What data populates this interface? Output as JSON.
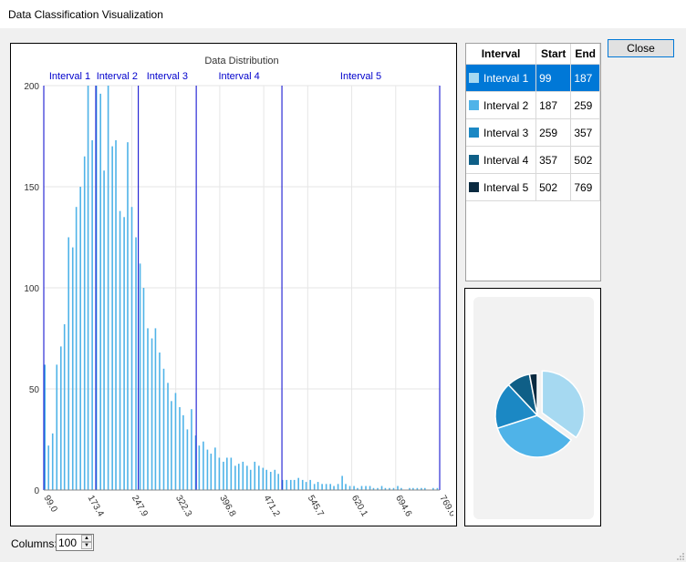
{
  "window": {
    "title": "Data Classification Visualization"
  },
  "close_label": "Close",
  "columns": {
    "label": "Columns:",
    "value": "100"
  },
  "table": {
    "headers": [
      "Interval",
      "Start",
      "End"
    ],
    "rows": [
      {
        "name": "Interval 1",
        "start": "99",
        "end": "187",
        "color": "#a6d9f1"
      },
      {
        "name": "Interval 2",
        "start": "187",
        "end": "259",
        "color": "#4fb3e8"
      },
      {
        "name": "Interval 3",
        "start": "259",
        "end": "357",
        "color": "#1b88c4"
      },
      {
        "name": "Interval 4",
        "start": "357",
        "end": "502",
        "color": "#0f5f87"
      },
      {
        "name": "Interval 5",
        "start": "502",
        "end": "769",
        "color": "#0a2a40"
      }
    ],
    "selected_row": 0
  },
  "chart_data": {
    "type": "bar",
    "title": "Data Distribution",
    "xlim": [
      99,
      769
    ],
    "ylim": [
      0,
      200
    ],
    "yticks": [
      0,
      50,
      100,
      150,
      200
    ],
    "xticks": [
      "99.0",
      "173.4",
      "247.9",
      "322.3",
      "396.8",
      "471.2",
      "545.7",
      "620.1",
      "694.6",
      "769.0"
    ],
    "grid": true,
    "bar_color": "#4fb3e8",
    "interval_line_color": "#0000cc",
    "interval_labels": [
      "Interval 1",
      "Interval 2",
      "Interval 3",
      "Interval 4",
      "Interval 5"
    ],
    "interval_breaks": [
      99,
      187,
      259,
      357,
      502,
      769
    ],
    "bin_centers": [
      101,
      107,
      114,
      121,
      128,
      134,
      141,
      148,
      154,
      161,
      168,
      174,
      181,
      188,
      195,
      201,
      208,
      215,
      221,
      228,
      235,
      241,
      248,
      255,
      262,
      268,
      275,
      282,
      288,
      295,
      302,
      309,
      315,
      322,
      329,
      335,
      342,
      349,
      356,
      362,
      369,
      376,
      382,
      389,
      396,
      403,
      409,
      416,
      423,
      429,
      436,
      443,
      449,
      456,
      463,
      470,
      476,
      483,
      490,
      496,
      503,
      510,
      517,
      523,
      530,
      537,
      543,
      550,
      557,
      563,
      570,
      577,
      584,
      590,
      597,
      604,
      610,
      617,
      624,
      630,
      637,
      644,
      651,
      657,
      664,
      671,
      677,
      684,
      691,
      698,
      704,
      711,
      718,
      724,
      731,
      738,
      744,
      751,
      758,
      765
    ],
    "counts": [
      62,
      22,
      28,
      62,
      71,
      82,
      125,
      120,
      140,
      150,
      165,
      200,
      173,
      200,
      196,
      158,
      200,
      170,
      173,
      138,
      135,
      172,
      140,
      125,
      112,
      100,
      80,
      75,
      80,
      68,
      60,
      53,
      44,
      48,
      41,
      37,
      30,
      40,
      27,
      22,
      24,
      20,
      18,
      21,
      16,
      14,
      16,
      16,
      12,
      13,
      14,
      12,
      10,
      14,
      12,
      11,
      10,
      9,
      10,
      8,
      5,
      5,
      5,
      5,
      6,
      5,
      4,
      5,
      3,
      4,
      3,
      3,
      3,
      2,
      3,
      7,
      3,
      2,
      2,
      1,
      2,
      2,
      2,
      1,
      1,
      2,
      1,
      1,
      1,
      2,
      1,
      0,
      1,
      1,
      1,
      1,
      1,
      0,
      1,
      1
    ]
  },
  "pie_data": {
    "type": "pie",
    "slices": [
      {
        "label": "Interval 1",
        "value": 35,
        "color": "#a6d9f1"
      },
      {
        "label": "Interval 2",
        "value": 35,
        "color": "#4fb3e8"
      },
      {
        "label": "Interval 3",
        "value": 18,
        "color": "#1b88c4"
      },
      {
        "label": "Interval 4",
        "value": 9,
        "color": "#0f5f87"
      },
      {
        "label": "Interval 5",
        "value": 3,
        "color": "#0a2a40"
      }
    ]
  }
}
